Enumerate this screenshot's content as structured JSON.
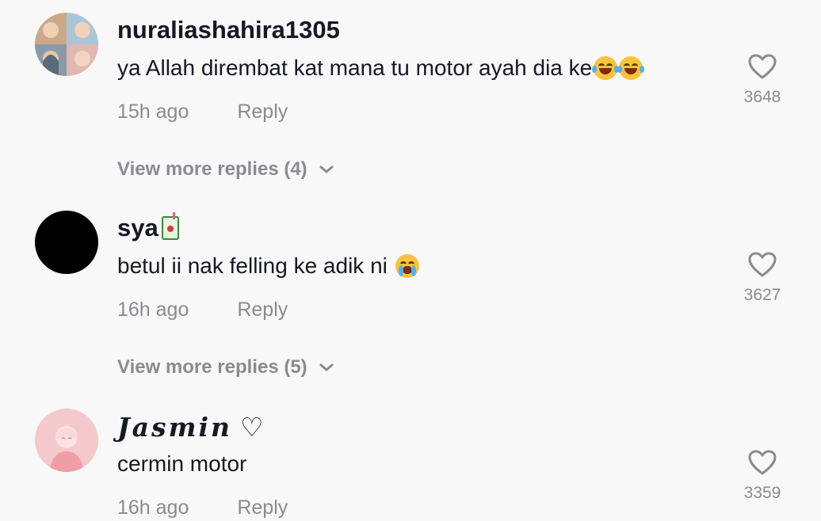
{
  "comments": [
    {
      "username": "nuraliashahira1305",
      "text": "ya Allah diremb at kat mana tu motor ayah dia ke",
      "emojis": [
        "joy-emoji",
        "joy-emoji"
      ],
      "time": "15h ago",
      "reply_label": "Reply",
      "likes": "3648",
      "view_more": "View more replies (4)",
      "avatar": "photo-collage-avatar"
    },
    {
      "username": "sya",
      "username_emoji": "juice-box-emoji",
      "text": "betul ii nak felling ke adik ni",
      "emojis": [
        "loudly-crying-emoji"
      ],
      "time": "16h ago",
      "reply_label": "Reply",
      "likes": "3627",
      "view_more": "View more replies (5)",
      "avatar": "black-circle-avatar"
    },
    {
      "username": "Jasmin",
      "username_suffix": "♡",
      "text": "cermin motor",
      "time": "16h ago",
      "reply_label": "Reply",
      "likes": "3359",
      "avatar": "pink-cartoon-avatar"
    }
  ],
  "colors": {
    "background": "#f8f8f8",
    "primary_text": "#161823",
    "secondary_text": "#8a8b91"
  },
  "icons": {
    "like": "heart-outline-icon",
    "expand": "chevron-down-icon"
  }
}
